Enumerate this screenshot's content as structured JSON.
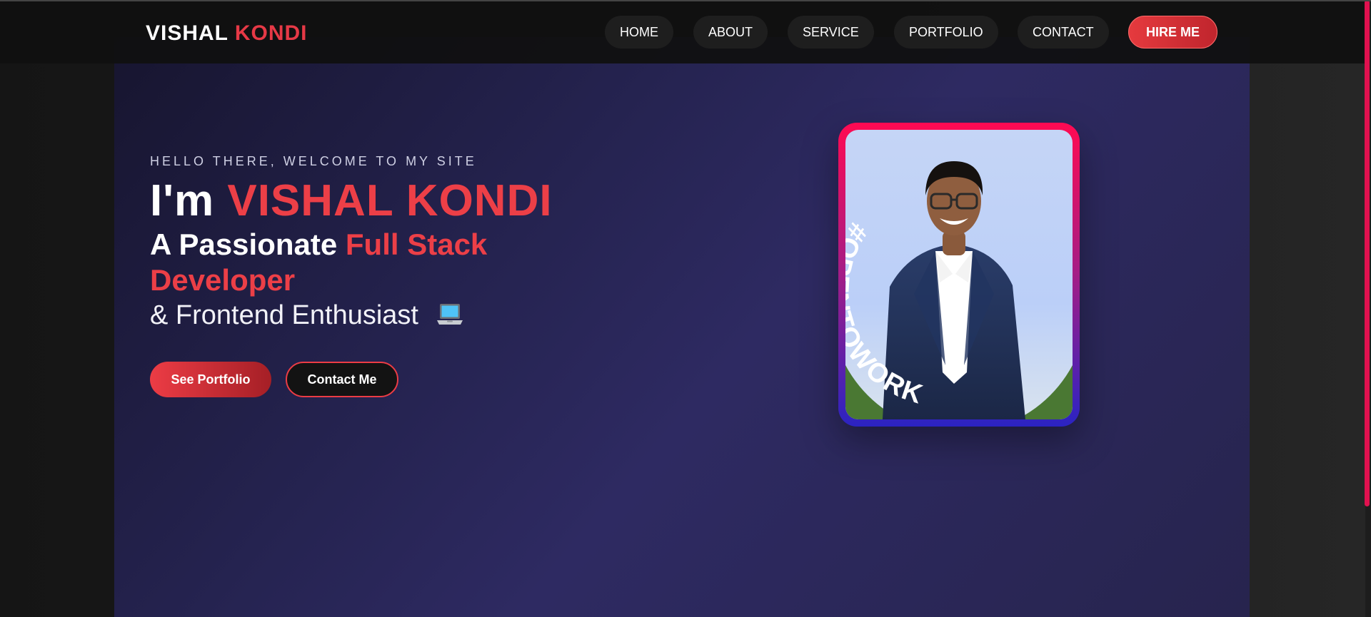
{
  "nav": {
    "logo_first": "VISHAL",
    "logo_second": "KONDI",
    "links": [
      "HOME",
      "ABOUT",
      "SERVICE",
      "PORTFOLIO",
      "CONTACT"
    ],
    "cta": "HIRE ME"
  },
  "hero": {
    "greeting": "HELLO THERE, WELCOME TO MY SITE",
    "headline_prefix": "I'm",
    "headline_name": "VISHAL KONDI",
    "subhead_prefix": "A Passionate",
    "subhead_accent": "Full Stack Developer",
    "tagline": "& Frontend Enthusiast",
    "tagline_icon": "laptop-icon",
    "buttons": {
      "primary": "See Portfolio",
      "secondary": "Contact Me"
    }
  },
  "profile": {
    "badge_text": "#OPENTOWORK"
  },
  "colors": {
    "accent": "#ec3f47",
    "frame_top": "#ff0a52",
    "frame_bottom": "#2b23c2",
    "badge_green": "#4a7833"
  }
}
